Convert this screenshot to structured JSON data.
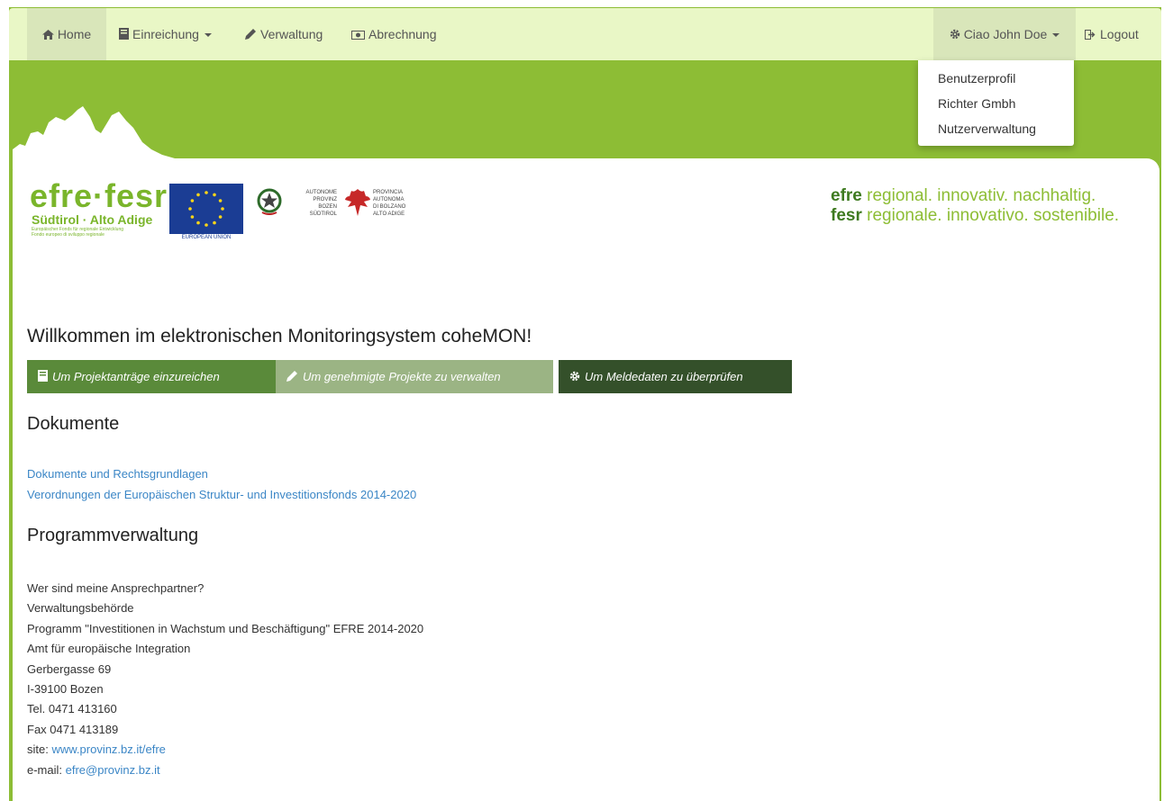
{
  "navbar": {
    "home": "Home",
    "einreichung": "Einreichung",
    "verwaltung": "Verwaltung",
    "abrechnung": "Abrechnung",
    "user": "Ciao John Doe",
    "logout": "Logout"
  },
  "user_menu": {
    "items": [
      "Benutzerprofil",
      "Richter Gmbh",
      "Nutzerverwaltung"
    ]
  },
  "logos": {
    "efre_title": "efre·fesr",
    "efre_sub": "Südtirol · Alto Adige",
    "efre_tiny_1": "Europäischer Fonds für regionale Entwicklung",
    "efre_tiny_2": "Fondo europeo di sviluppo regionale",
    "eu_label": "EUROPEAN UNION",
    "prov_de": [
      "AUTONOME",
      "PROVINZ",
      "BOZEN",
      "SÜDTIROL"
    ],
    "prov_it": [
      "PROVINCIA",
      "AUTONOMA",
      "DI BOLZANO",
      "ALTO ADIGE"
    ]
  },
  "slogan": {
    "line1_bold": "efre",
    "line1": " regional. innovativ. nachhaltig.",
    "line2_bold": "fesr",
    "line2": " regionale. innovativo. sostenibile."
  },
  "main": {
    "welcome": "Willkommen im elektronischen Monitoringsystem coheMON!",
    "buttons": [
      "Um Projektanträge einzureichen",
      "Um genehmigte Projekte zu verwalten",
      "Um Meldedaten zu überprüfen"
    ],
    "documents_title": "Dokumente",
    "documents": [
      "Dokumente und Rechtsgrundlagen",
      "Verordnungen der Europäischen Struktur- und Investitionsfonds 2014-2020"
    ],
    "program_title": "Programmverwaltung",
    "contact": {
      "line1": "Wer sind meine Ansprechpartner?",
      "line2": "Verwaltungsbehörde",
      "line3": "Programm \"Investitionen in Wachstum und Beschäftigung\" EFRE 2014-2020",
      "line4": "Amt für europäische Integration",
      "line5": "Gerbergasse 69",
      "line6": "I-39100 Bozen",
      "line7": "Tel. 0471 413160",
      "line8": "Fax 0471 413189",
      "site_label": "site: ",
      "site": "www.provinz.bz.it/efre",
      "email_label": "e-mail: ",
      "email": "efre@provinz.bz.it"
    }
  },
  "colors": {
    "brand_green": "#8dbd35",
    "navbar_bg": "#e9f7c6",
    "link_blue": "#3b86c6"
  }
}
